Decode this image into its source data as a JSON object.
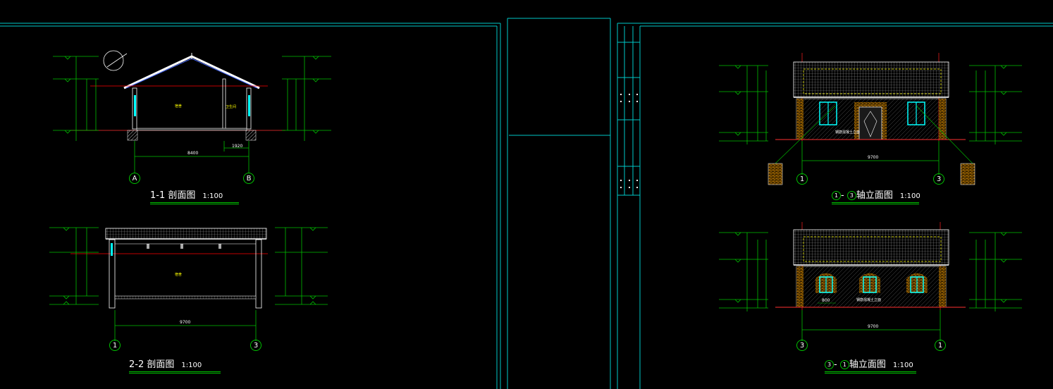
{
  "section_1_1": {
    "title": "1-1   剖面图",
    "scale": "1:100",
    "axis_left": "A",
    "axis_right": "B",
    "span": "8400",
    "sub_span": "1920",
    "room_left": "宿舍",
    "room_right": "卫生间"
  },
  "section_2_2": {
    "title": "2-2   剖面图",
    "scale": "1:100",
    "axis_left": "1",
    "axis_right": "3",
    "span": "9700",
    "room": "宿舍"
  },
  "elevation_1_3": {
    "title_a": "1",
    "title_sep": "-",
    "title_b": "3",
    "title_text": "轴立面图",
    "scale": "1:100",
    "axis_left": "1",
    "axis_right": "3",
    "span": "9700",
    "note": "钢筋混凝土立面"
  },
  "elevation_3_1": {
    "title_a": "3",
    "title_sep": "-",
    "title_b": "1",
    "title_text": "轴立面图",
    "scale": "1:100",
    "axis_left": "3",
    "axis_right": "1",
    "span": "9700",
    "window_dim": "800",
    "note": "钢筋混凝土立面"
  },
  "colors": {
    "frame": "#00c8c8",
    "dim": "#00c000",
    "section_cut": "#ff0000",
    "hatch": "#ffffff",
    "wall": "#ffa500",
    "window": "#00ffff",
    "text": "#ffffff",
    "room_label": "#ffff00"
  }
}
